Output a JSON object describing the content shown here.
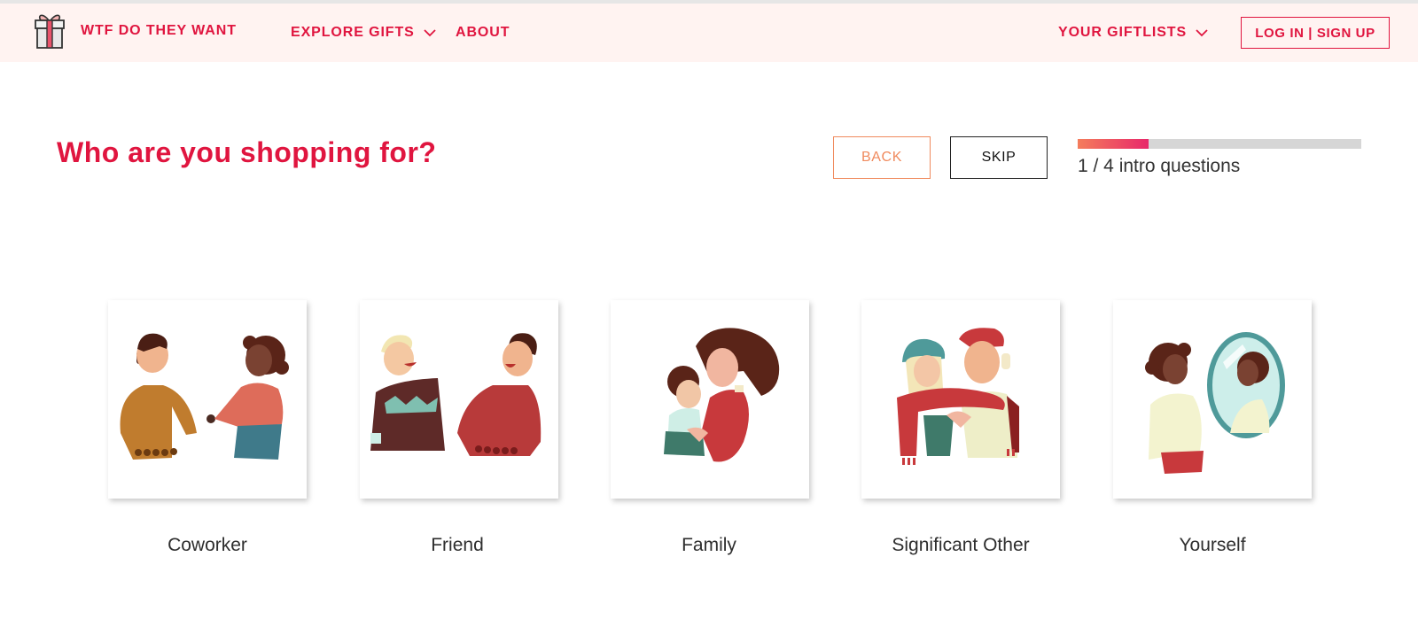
{
  "header": {
    "brand": "WTF DO THEY WANT",
    "nav": {
      "explore": "EXPLORE GIFTS",
      "about": "ABOUT",
      "giftlists": "YOUR GIFTLISTS"
    },
    "login": "LOG IN | SIGN UP"
  },
  "main": {
    "question": "Who are you shopping for?",
    "back": "BACK",
    "skip": "SKIP",
    "progress": {
      "current": 1,
      "total": 4,
      "fraction": 0.25,
      "text": "1 / 4 intro questions"
    }
  },
  "options": [
    {
      "label": "Coworker"
    },
    {
      "label": "Friend"
    },
    {
      "label": "Family"
    },
    {
      "label": "Significant Other"
    },
    {
      "label": "Yourself"
    }
  ],
  "colors": {
    "brand": "#e0153f",
    "header_bg": "#fff3f1",
    "back_border": "#f08a5d",
    "progress_start": "#f47d5c",
    "progress_end": "#e8286a",
    "progress_track": "#d6d6d6"
  },
  "icons": {
    "logo": "gift-box-icon",
    "dropdown": "chevron-down-icon"
  }
}
